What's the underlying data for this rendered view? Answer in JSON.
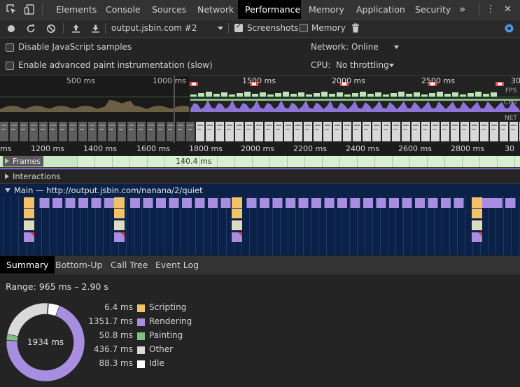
{
  "devtools": {
    "tabs": [
      {
        "label": "Elements"
      },
      {
        "label": "Console"
      },
      {
        "label": "Sources"
      },
      {
        "label": "Network"
      },
      {
        "label": "Performance"
      },
      {
        "label": "Memory"
      },
      {
        "label": "Application"
      },
      {
        "label": "Security"
      }
    ],
    "more_tabs_glyph": "»",
    "menu_glyph": "⋮",
    "close_glyph": "✕"
  },
  "toolbar": {
    "profile_select": "output.jsbin.com #2",
    "screenshots_label": "Screenshots",
    "screenshots_checked": true,
    "memory_label": "Memory",
    "memory_checked": false
  },
  "settings": {
    "disable_js_samples": "Disable JavaScript samples",
    "advanced_paint": "Enable advanced paint instrumentation (slow)",
    "network_label": "Network:",
    "network_value": "Online",
    "cpu_label": "CPU:",
    "cpu_value": "No throttling"
  },
  "overview": {
    "ticks": [
      "500 ms",
      "1000 ms",
      "1500 ms",
      "2000 ms",
      "2500 ms",
      "30"
    ],
    "lanes": [
      "FPS",
      "CPU",
      "NET"
    ]
  },
  "ruler": {
    "ticks": [
      "ms",
      "1200 ms",
      "1400 ms",
      "1600 ms",
      "1800 ms",
      "2000 ms",
      "2200 ms",
      "2400 ms",
      "2600 ms",
      "2800 ms",
      "30"
    ]
  },
  "tracks": {
    "frames_label": "Frames",
    "frame_time": "140.4 ms",
    "interactions_label": "Interactions",
    "main_label": "Main — http://output.jsbin.com/nanana/2/quiet"
  },
  "bottom_tabs": [
    {
      "label": "Summary"
    },
    {
      "label": "Bottom-Up"
    },
    {
      "label": "Call Tree"
    },
    {
      "label": "Event Log"
    }
  ],
  "summary": {
    "range": "Range: 965 ms – 2.90 s",
    "total": "1934 ms",
    "items": [
      {
        "value": "6.4 ms",
        "name": "Scripting",
        "ms": 6.4,
        "color": "#f2c26b"
      },
      {
        "value": "1351.7 ms",
        "name": "Rendering",
        "ms": 1351.7,
        "color": "#a88ee0"
      },
      {
        "value": "50.8 ms",
        "name": "Painting",
        "ms": 50.8,
        "color": "#7fbf7f"
      },
      {
        "value": "436.7 ms",
        "name": "Other",
        "ms": 436.7,
        "color": "#dadada"
      },
      {
        "value": "88.3 ms",
        "name": "Idle",
        "ms": 88.3,
        "color": "#ffffff"
      }
    ]
  }
}
